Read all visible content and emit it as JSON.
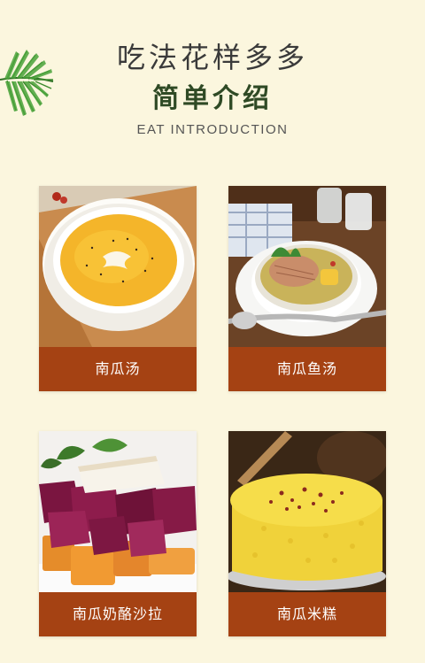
{
  "header": {
    "title": "吃法花样多多",
    "subtitle": "简单介绍",
    "subtitle_en": "EAT INTRODUCTION"
  },
  "cards": [
    {
      "label": "南瓜汤",
      "image": "pumpkin-soup-photo"
    },
    {
      "label": "南瓜鱼汤",
      "image": "pumpkin-fish-soup-photo"
    },
    {
      "label": "南瓜奶酪沙拉",
      "image": "pumpkin-cheese-salad-photo"
    },
    {
      "label": "南瓜米糕",
      "image": "pumpkin-rice-cake-photo"
    }
  ],
  "colors": {
    "background": "#fbf6de",
    "label_bar": "#a54213",
    "subtitle": "#2f4a25"
  }
}
